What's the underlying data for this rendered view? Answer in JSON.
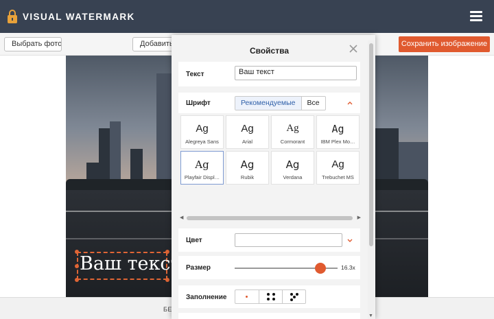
{
  "app": {
    "name": "VISUAL WATERMARK"
  },
  "toolbar": {
    "choose_photo_label": "Выбрать фото",
    "add_label": "Добавить",
    "save_label": "Сохранить изображение"
  },
  "watermark": {
    "text": "Ваш текст"
  },
  "bottom": {
    "text": "БЕС"
  },
  "panel": {
    "title": "Свойства",
    "text_label": "Текст",
    "text_value": "Ваш текст",
    "font_label": "Шрифт",
    "font_tabs": {
      "recommended": "Рекомендуемые",
      "all": "Все"
    },
    "fonts": [
      {
        "name": "Alegreya Sans",
        "sample": "Ag"
      },
      {
        "name": "Arial",
        "sample": "Ag"
      },
      {
        "name": "Cormorant",
        "sample": "Ag"
      },
      {
        "name": "IBM Plex Mo…",
        "sample": "Ag"
      },
      {
        "name": "Playfair Displ…",
        "sample": "Ag"
      },
      {
        "name": "Rubik",
        "sample": "Ag"
      },
      {
        "name": "Verdana",
        "sample": "Ag"
      },
      {
        "name": "Trebuchet MS",
        "sample": "Ag"
      }
    ],
    "selected_font": "Playfair Displ…",
    "color_label": "Цвет",
    "size_label": "Размер",
    "size_value": "16.3x",
    "size_level": 0.83,
    "fill_label": "Заполнение"
  },
  "colors": {
    "header": "#384252",
    "accent": "#e05a2f",
    "selection": "#e06535"
  },
  "icons": [
    "lock-logo-icon",
    "hamburger-menu-icon",
    "close-icon",
    "chevron-up-icon",
    "chevron-down-icon"
  ]
}
